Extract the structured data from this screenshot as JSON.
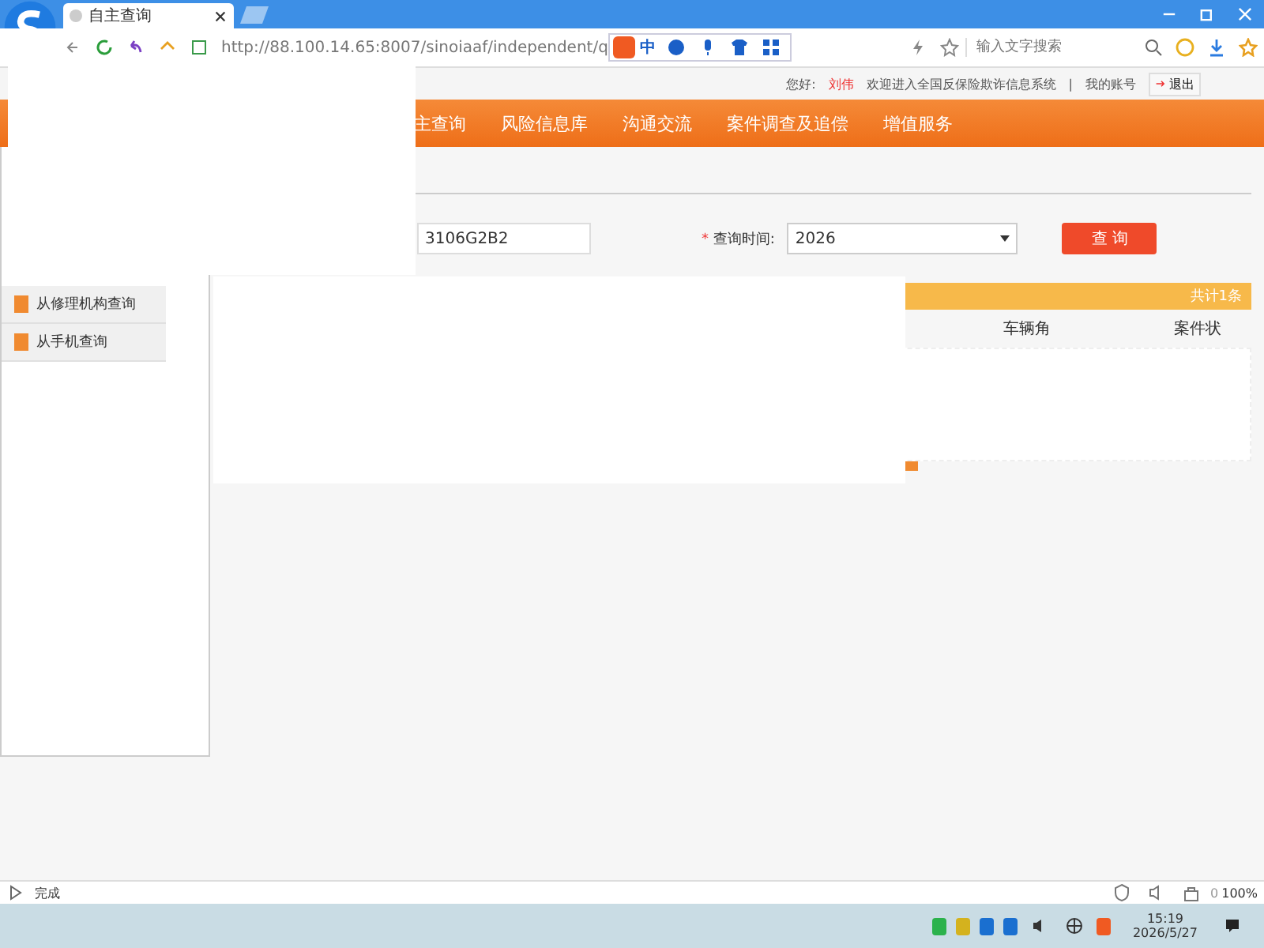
{
  "browser": {
    "tab": {
      "title": "自主查询"
    },
    "address": "http://88.100.14.65:8007/sinoiaaf/independent/q",
    "ime_label": "中",
    "search": {
      "placeholder": "输入文字搜索"
    }
  },
  "user_bar": {
    "greeting": "您好:",
    "user_name": "刘伟",
    "welcome": "欢迎进入全国反保险欺诈信息系统",
    "separator": "|",
    "account_link": "我的账号",
    "logout": "退出"
  },
  "nav": [
    {
      "label": "主查询"
    },
    {
      "label": "风险信息库"
    },
    {
      "label": "沟通交流"
    },
    {
      "label": "案件调查及追偿"
    },
    {
      "label": "增值服务"
    }
  ],
  "sidebar": {
    "items": [
      {
        "label": "从修理机构查询"
      },
      {
        "label": "从手机查询"
      }
    ]
  },
  "query_form": {
    "field_value": "3106G2B2",
    "required_mark": "*",
    "time_label": "查询时间:",
    "time_select": "2026",
    "submit": "查 询"
  },
  "results": {
    "count_label": "共计1条",
    "columns": [
      "车辆角",
      "案件状"
    ]
  },
  "status_bar": {
    "status": "完成",
    "blocked_count": "0",
    "zoom": "100%"
  },
  "taskbar": {
    "time": "15:19",
    "date": "2026/5/27"
  }
}
